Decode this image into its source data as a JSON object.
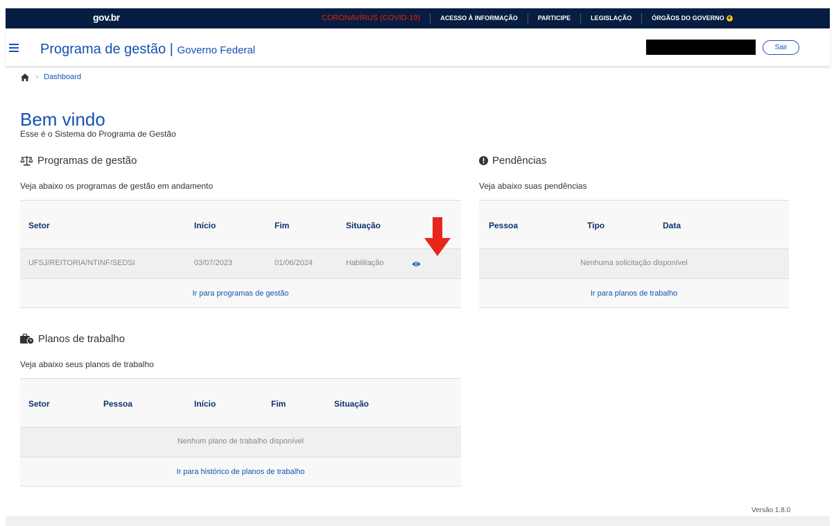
{
  "govbar": {
    "logo": "gov.br",
    "links": [
      "CORONAVÍRUS (COVID-19)",
      "ACESSO À INFORMAÇÃO",
      "PARTICIPE",
      "LEGISLAÇÃO",
      "ÓRGÃOS DO GOVERNO"
    ],
    "covid_color": "#e52207"
  },
  "header": {
    "title": "Programa de gestão",
    "separator": "|",
    "subtitle": "Governo Federal",
    "logout_label": "Sair"
  },
  "breadcrumb": {
    "separator": ">",
    "current": "Dashboard"
  },
  "welcome": {
    "title": "Bem vindo",
    "subtitle": "Esse é o Sistema do Programa de Gestão"
  },
  "programas": {
    "title": "Programas de gestão",
    "description": "Veja abaixo os programas de gestão em andamento",
    "columns": [
      "Setor",
      "Início",
      "Fim",
      "Situação"
    ],
    "rows": [
      {
        "setor": "UFSJ/REITORIA/NTINF/SEDSI",
        "inicio": "03/07/2023",
        "fim": "01/06/2024",
        "situacao": "Habilitação"
      }
    ],
    "footer_link": "Ir para programas de gestão"
  },
  "pendencias": {
    "title": "Pendências",
    "description": "Veja abaixo suas pendências",
    "columns": [
      "Pessoa",
      "Tipo",
      "Data"
    ],
    "empty": "Nenhuma solicitação disponível",
    "footer_link": "Ir para planos de trabalho"
  },
  "planos": {
    "title": "Planos de trabalho",
    "description": "Veja abaixo seus planos de trabalho",
    "columns": [
      "Setor",
      "Pessoa",
      "Início",
      "Fim",
      "Situação"
    ],
    "empty": "Nenhum plano de trabalho disponível",
    "footer_link": "Ir para histórico de planos de trabalho"
  },
  "footer": {
    "version": "Versão 1.8.0"
  },
  "colors": {
    "primary": "#1351b4",
    "govbar_bg": "#071d41",
    "arrow": "#e8261c"
  }
}
